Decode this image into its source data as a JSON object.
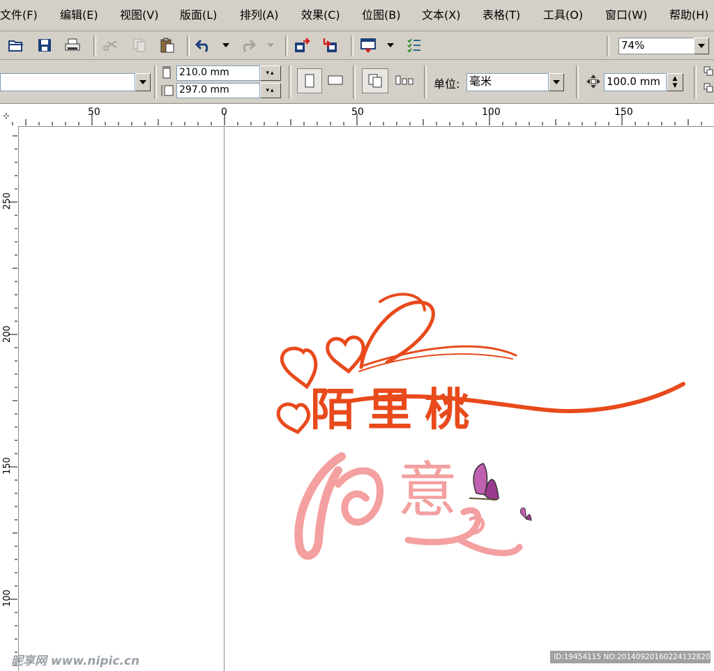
{
  "menu": {
    "items": [
      "文件(F)",
      "编辑(E)",
      "视图(V)",
      "版面(L)",
      "排列(A)",
      "效果(C)",
      "位图(B)",
      "文本(X)",
      "表格(T)",
      "工具(O)",
      "窗口(W)",
      "帮助(H)"
    ]
  },
  "toolbar": {
    "zoom_value": "74%",
    "icons": [
      "open-icon",
      "save-icon",
      "print-icon",
      "cut-icon",
      "copy-icon",
      "paste-icon",
      "undo-icon",
      "redo-icon",
      "import-icon",
      "export-icon",
      "application-launcher-icon",
      "options-icon"
    ]
  },
  "property_bar": {
    "page_preset_value": "",
    "width_value": "210.0 mm",
    "height_value": "297.0 mm",
    "unit_label": "单位:",
    "unit_value": "毫米",
    "nudge_value": "100.0 mm"
  },
  "ruler": {
    "h_labels": [
      "50",
      "0",
      "50",
      "100",
      "150"
    ],
    "v_labels": [
      "250",
      "200",
      "150",
      "100"
    ]
  },
  "artwork": {
    "title_chars": [
      "陌",
      "里",
      "桃"
    ],
    "subtitle_chars": [
      "如",
      "意"
    ],
    "primary_color": "#e84a1c",
    "secondary_color": "#f4a0a0",
    "butterfly_color": "#c060b0"
  },
  "watermark": {
    "left_text": "昵享网 www.nipic.cn",
    "right_text": "ID:19454115 NO:20140920160224132820"
  }
}
